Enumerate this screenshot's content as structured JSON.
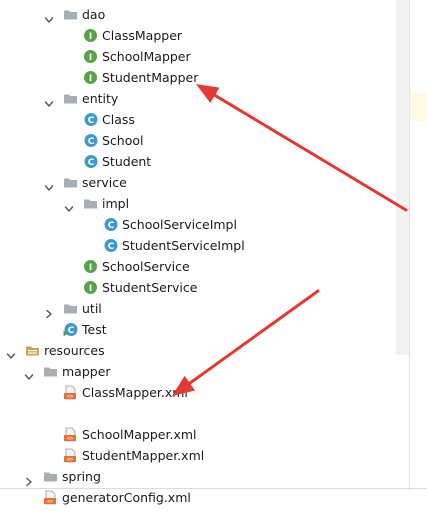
{
  "colors": {
    "folder": "#a9adb5",
    "interface_icon": "#5aa24a",
    "class_icon": "#3e9ac9",
    "xml_icon": "#e0743a",
    "resources_folder": "#c8a35b",
    "annotation_arrow": "#e53935"
  },
  "tree": [
    {
      "label": "dao",
      "icon": "folder-icon",
      "expanded": true
    },
    {
      "label": "ClassMapper",
      "icon": "interface-icon",
      "expanded": null
    },
    {
      "label": "SchoolMapper",
      "icon": "interface-icon",
      "expanded": null
    },
    {
      "label": "StudentMapper",
      "icon": "interface-icon",
      "expanded": null
    },
    {
      "label": "entity",
      "icon": "folder-icon",
      "expanded": true
    },
    {
      "label": "Class",
      "icon": "class-icon",
      "expanded": null
    },
    {
      "label": "School",
      "icon": "class-icon",
      "expanded": null
    },
    {
      "label": "Student",
      "icon": "class-icon",
      "expanded": null
    },
    {
      "label": "service",
      "icon": "folder-icon",
      "expanded": true
    },
    {
      "label": "impl",
      "icon": "folder-icon",
      "expanded": true
    },
    {
      "label": "SchoolServiceImpl",
      "icon": "class-icon",
      "expanded": null
    },
    {
      "label": "StudentServiceImpl",
      "icon": "class-icon",
      "expanded": null
    },
    {
      "label": "SchoolService",
      "icon": "interface-icon",
      "expanded": null
    },
    {
      "label": "StudentService",
      "icon": "interface-icon",
      "expanded": null
    },
    {
      "label": "util",
      "icon": "folder-icon",
      "expanded": false
    },
    {
      "label": "Test",
      "icon": "runnable-class-icon",
      "expanded": null
    },
    {
      "label": "resources",
      "icon": "resources-folder-icon",
      "expanded": true
    },
    {
      "label": "mapper",
      "icon": "folder-icon",
      "expanded": true
    },
    {
      "label": "ClassMapper.xml",
      "icon": "xml-file-icon",
      "expanded": null
    },
    {
      "label": "SchoolMapper.xml",
      "icon": "xml-file-icon",
      "expanded": null
    },
    {
      "label": "StudentMapper.xml",
      "icon": "xml-file-icon",
      "expanded": null
    },
    {
      "label": "spring",
      "icon": "folder-icon",
      "expanded": false
    },
    {
      "label": "generatorConfig.xml",
      "icon": "xml-file-icon",
      "expanded": null
    }
  ]
}
